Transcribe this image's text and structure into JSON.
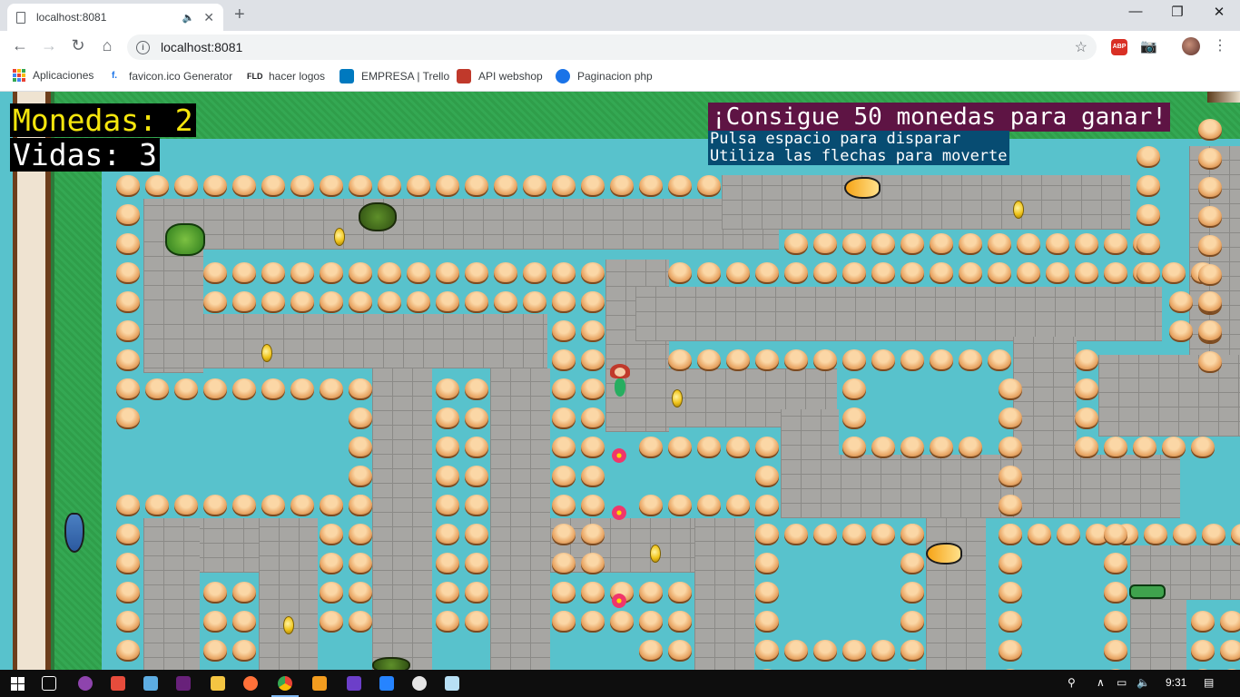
{
  "browser": {
    "tab_title": "localhost:8081",
    "tab_audio_icon": "speaker-icon",
    "url": "localhost:8081",
    "bookmarks": [
      {
        "label": "Aplicaciones",
        "icon": "apps-grid-icon"
      },
      {
        "label": "favicon.ico Generator",
        "icon": "favicon-icon"
      },
      {
        "label": "hacer logos",
        "icon": "fld-icon"
      },
      {
        "label": "EMPRESA | Trello",
        "icon": "trello-icon"
      },
      {
        "label": "API webshop",
        "icon": "api-icon"
      },
      {
        "label": "Paginacion php",
        "icon": "pagination-icon"
      }
    ],
    "extensions": {
      "abp": "ABP"
    }
  },
  "game": {
    "coins_label": "Monedas: 2",
    "lives_label": "Vidas: 3",
    "goal_text": "¡Consigue 50 monedas para ganar!",
    "help_lines": [
      "Pulsa espacio para disparar",
      "Utiliza las flechas para moverte"
    ],
    "coins": 2,
    "lives": 3,
    "goal_coins": 50
  },
  "taskbar": {
    "time": "9:31",
    "apps": [
      "start-icon",
      "task-view-icon",
      "app-purple-icon",
      "app-red-icon",
      "app-cube-icon",
      "visual-studio-icon",
      "file-explorer-icon",
      "firefox-icon",
      "chrome-icon",
      "sublime-icon",
      "app-grid-icon",
      "sourcetree-icon",
      "app-paint-icon",
      "app-notes-icon"
    ]
  },
  "colors": {
    "water": "#58c2cc",
    "grass": "#34a853",
    "coins_hud": "#f5e60d",
    "goal_bg": "#5e1444",
    "help_bg": "#074c72"
  }
}
